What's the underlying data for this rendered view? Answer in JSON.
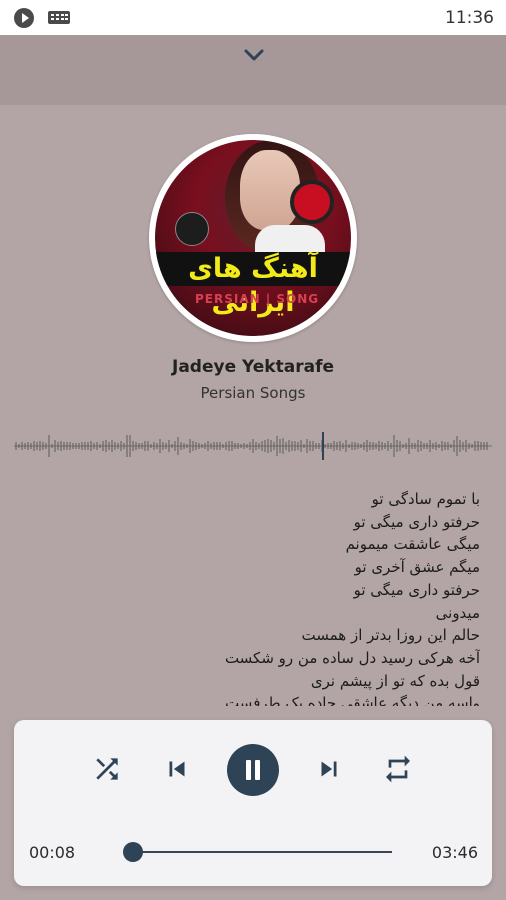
{
  "status_bar": {
    "time": "11:36",
    "icons": [
      "play-notification-icon",
      "keyboard-icon"
    ]
  },
  "header": {
    "collapse_icon": "chevron-down-icon"
  },
  "album": {
    "art_title_text": "آهنگ های ایرانی",
    "art_footer_text": "PERSIAN | SONG"
  },
  "track": {
    "title": "Jadeye Yektarafe",
    "artist": "Persian Songs"
  },
  "lyrics": [
    "با تموم سادگی تو",
    "حرفتو داری میگی تو",
    "میگی عاشقت میمونم",
    "میگم عشق آخری تو",
    "حرفتو داری میگی تو",
    "میدونی",
    "حالم این روزا بدتر از همست",
    "آخه هرکی رسید دل ساده من رو شکست",
    "قول بده که تو از پیشم نری",
    "واسه من دیگه عاشقی جاده یک طرفست"
  ],
  "player": {
    "controls": [
      "shuffle-icon",
      "previous-icon",
      "pause-icon",
      "next-icon",
      "repeat-icon"
    ],
    "current_time": "00:08",
    "total_time": "03:46",
    "progress": 0.035
  },
  "colors": {
    "background": "#b3a5a5",
    "header_band": "#a69898",
    "accent": "#2f4357",
    "card": "#f3f2f4"
  }
}
